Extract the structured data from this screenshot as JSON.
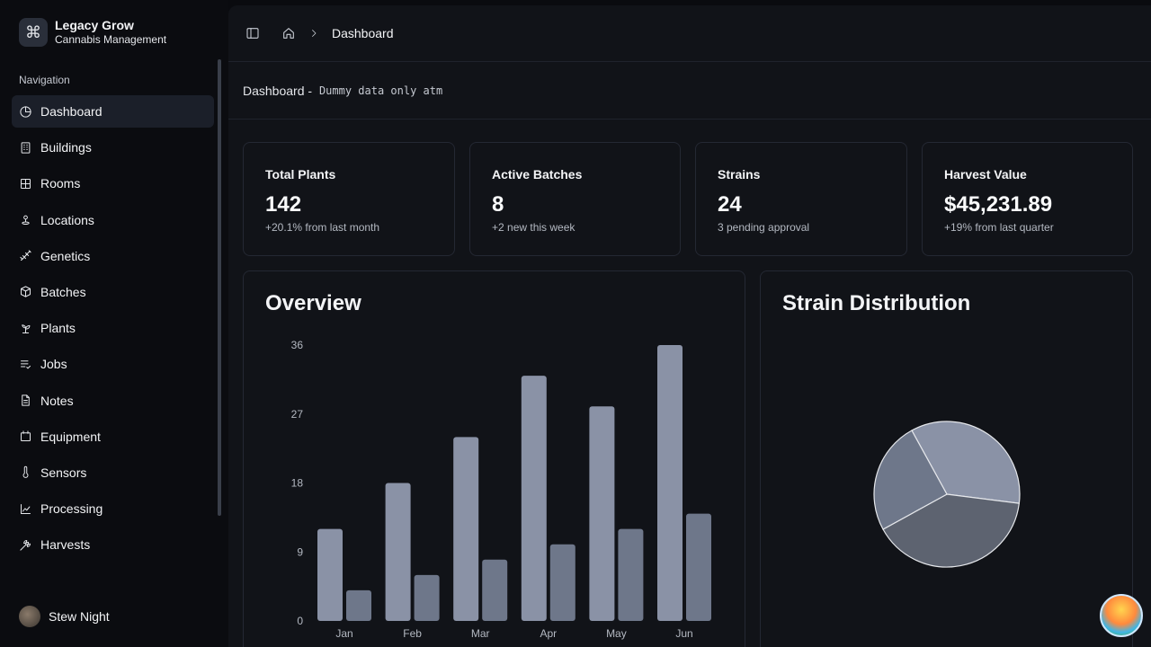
{
  "brand": {
    "title": "Legacy Grow",
    "subtitle": "Cannabis Management",
    "logo_icon": "command-icon"
  },
  "nav_heading": "Navigation",
  "nav": [
    {
      "label": "Dashboard",
      "icon": "pie-chart-icon",
      "active": true
    },
    {
      "label": "Buildings",
      "icon": "building-icon"
    },
    {
      "label": "Rooms",
      "icon": "grid-icon"
    },
    {
      "label": "Locations",
      "icon": "map-pin-icon"
    },
    {
      "label": "Genetics",
      "icon": "dna-icon"
    },
    {
      "label": "Batches",
      "icon": "box-icon"
    },
    {
      "label": "Plants",
      "icon": "sprout-icon"
    },
    {
      "label": "Jobs",
      "icon": "list-check-icon"
    },
    {
      "label": "Notes",
      "icon": "file-text-icon"
    },
    {
      "label": "Equipment",
      "icon": "calendar-icon"
    },
    {
      "label": "Sensors",
      "icon": "thermometer-icon"
    },
    {
      "label": "Processing",
      "icon": "area-chart-icon"
    },
    {
      "label": "Harvests",
      "icon": "wheat-icon"
    }
  ],
  "user": {
    "name": "Stew Night"
  },
  "breadcrumb": {
    "current": "Dashboard"
  },
  "subheader": {
    "title": "Dashboard - ",
    "note": "Dummy data only atm"
  },
  "stats": [
    {
      "title": "Total Plants",
      "value": "142",
      "sub": "+20.1% from last month"
    },
    {
      "title": "Active Batches",
      "value": "8",
      "sub": "+2 new this week"
    },
    {
      "title": "Strains",
      "value": "24",
      "sub": "3 pending approval"
    },
    {
      "title": "Harvest Value",
      "value": "$45,231.89",
      "sub": "+19% from last quarter"
    }
  ],
  "overview": {
    "title": "Overview"
  },
  "strain": {
    "title": "Strain Distribution"
  },
  "colors": {
    "bar_primary": "#8a92a6",
    "bar_secondary": "#6e778a",
    "pie": [
      "#8a92a6",
      "#5d6370",
      "#6e778a"
    ]
  },
  "chart_data": [
    {
      "type": "bar",
      "title": "Overview",
      "categories": [
        "Jan",
        "Feb",
        "Mar",
        "Apr",
        "May",
        "Jun"
      ],
      "series": [
        {
          "values": [
            12,
            18,
            24,
            32,
            28,
            36
          ]
        },
        {
          "values": [
            4,
            6,
            8,
            10,
            12,
            14
          ]
        }
      ],
      "yticks": [
        0,
        9,
        18,
        27,
        36
      ],
      "ylim": [
        0,
        36
      ]
    },
    {
      "type": "pie",
      "title": "Strain Distribution",
      "values": [
        35,
        40,
        25
      ]
    }
  ]
}
